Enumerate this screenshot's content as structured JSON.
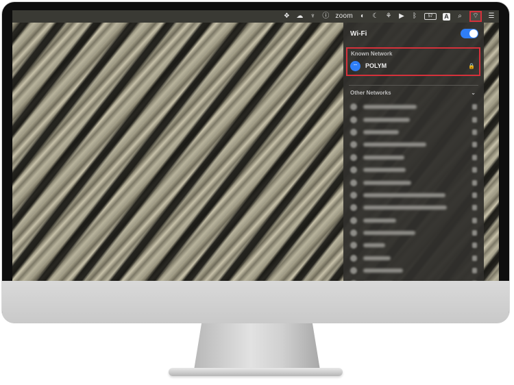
{
  "menubar": {
    "icons": [
      "dropbox-icon",
      "creative-cloud-icon",
      "bird-icon",
      "info-icon",
      "zoom-icon",
      "screen-icon",
      "moon-icon",
      "fan-icon",
      "play-icon",
      "bluetooth-icon",
      "battery-icon",
      "input-source-icon",
      "search-icon",
      "wifi-icon",
      "control-center-icon"
    ],
    "zoom_label": "zoom",
    "battery_label": "57",
    "input_source_label": "A"
  },
  "wifi_panel": {
    "title": "Wi-Fi",
    "enabled": true,
    "known_header": "Known Network",
    "known_network": "POLYM",
    "other_header": "Other Networks",
    "other_networks_count_visible": 15
  },
  "colors": {
    "highlight": "#d6313b",
    "accent": "#2f7ef6"
  }
}
